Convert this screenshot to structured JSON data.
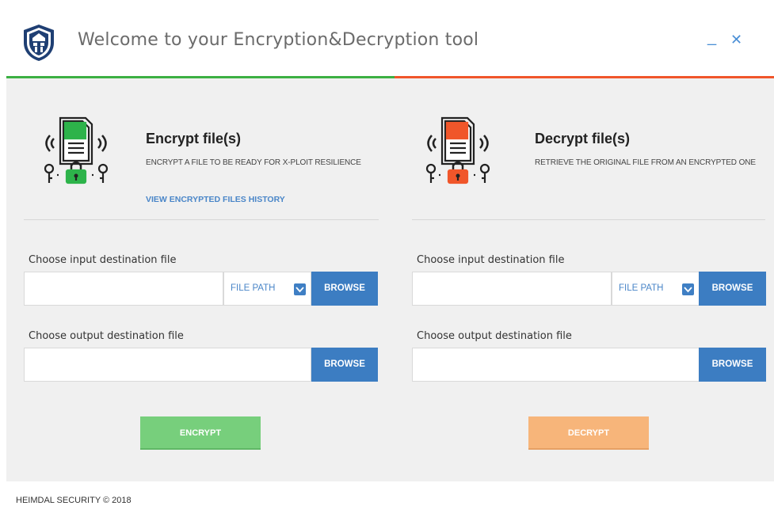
{
  "window": {
    "title": "Welcome to your Encryption&Decryption tool",
    "minimize_label": "_",
    "close_label": "✕"
  },
  "encrypt_panel": {
    "heading": "Encrypt file(s)",
    "subtitle": "ENCRYPT A FILE TO BE READY FOR X-PLOIT RESILIENCE",
    "history_link": "VIEW ENCRYPTED FILES HISTORY",
    "input_label": "Choose input destination file",
    "input_value": "",
    "path_selector": "FILE PATH",
    "browse_input": "BROWSE",
    "output_label": "Choose output destination file",
    "output_value": "",
    "browse_output": "BROWSE",
    "action": "ENCRYPT",
    "accent": "#3cb043"
  },
  "decrypt_panel": {
    "heading": "Decrypt file(s)",
    "subtitle": "RETRIEVE THE ORIGINAL FILE FROM AN ENCRYPTED ONE",
    "input_label": "Choose input destination file",
    "input_value": "",
    "path_selector": "FILE PATH",
    "browse_input": "BROWSE",
    "output_label": "Choose output destination file",
    "output_value": "",
    "browse_output": "BROWSE",
    "action": "DECRYPT",
    "accent": "#f0562a"
  },
  "footer": {
    "copyright": "HEIMDAL SECURITY  © 2018"
  },
  "icons": [
    "shield-logo-icon",
    "encrypt-document-lock-icon",
    "decrypt-document-lock-icon",
    "chevron-down-icon"
  ]
}
